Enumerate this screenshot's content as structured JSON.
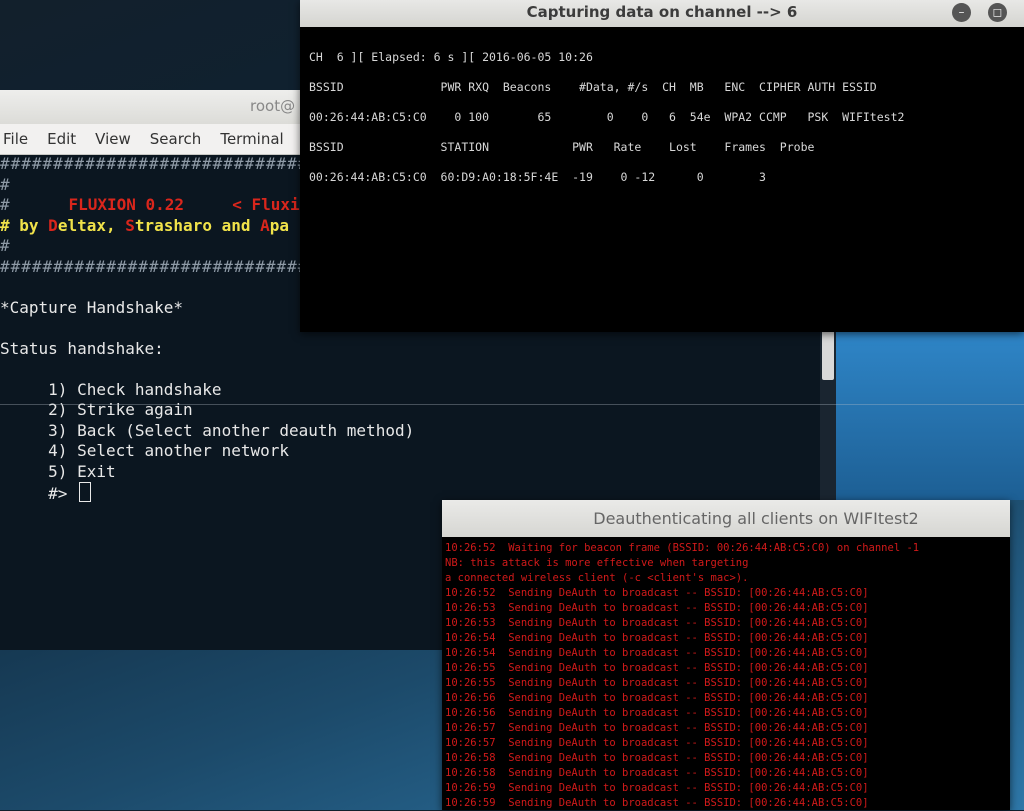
{
  "main_terminal": {
    "title": "root@",
    "menu": [
      "File",
      "Edit",
      "View",
      "Search",
      "Terminal",
      ""
    ],
    "hash_line": "#################################",
    "hash_mark": "#",
    "banner_name": "FLUXION 0.22",
    "banner_tag": "< Fluxi",
    "byline_parts": [
      "# by ",
      "D",
      "eltax, ",
      "S",
      "trasharo and ",
      "A",
      "pa"
    ],
    "capture_heading": "*Capture Handshake*",
    "status_label": "Status handshake:",
    "options": [
      "1) Check handshake",
      "2) Strike again",
      "3) Back (Select another deauth method)",
      "4) Select another network",
      "5) Exit"
    ],
    "prompt": "#>"
  },
  "capture_window": {
    "title": "Capturing data on channel --> 6",
    "lines": [
      "CH  6 ][ Elapsed: 6 s ][ 2016-06-05 10:26",
      "BSSID              PWR RXQ  Beacons    #Data, #/s  CH  MB   ENC  CIPHER AUTH ESSID",
      "00:26:44:AB:C5:C0    0 100       65        0    0   6  54e  WPA2 CCMP   PSK  WIFItest2",
      "BSSID              STATION            PWR   Rate    Lost    Frames  Probe",
      "00:26:44:AB:C5:C0  60:D9:A0:18:5F:4E  -19    0 -12      0        3"
    ]
  },
  "deauth_window": {
    "title": "Deauthenticating all clients on WIFItest2",
    "lines": [
      "10:26:52  Waiting for beacon frame (BSSID: 00:26:44:AB:C5:C0) on channel -1",
      "NB: this attack is more effective when targeting",
      "a connected wireless client (-c <client's mac>).",
      "10:26:52  Sending DeAuth to broadcast -- BSSID: [00:26:44:AB:C5:C0]",
      "10:26:53  Sending DeAuth to broadcast -- BSSID: [00:26:44:AB:C5:C0]",
      "10:26:53  Sending DeAuth to broadcast -- BSSID: [00:26:44:AB:C5:C0]",
      "10:26:54  Sending DeAuth to broadcast -- BSSID: [00:26:44:AB:C5:C0]",
      "10:26:54  Sending DeAuth to broadcast -- BSSID: [00:26:44:AB:C5:C0]",
      "10:26:55  Sending DeAuth to broadcast -- BSSID: [00:26:44:AB:C5:C0]",
      "10:26:55  Sending DeAuth to broadcast -- BSSID: [00:26:44:AB:C5:C0]",
      "10:26:56  Sending DeAuth to broadcast -- BSSID: [00:26:44:AB:C5:C0]",
      "10:26:56  Sending DeAuth to broadcast -- BSSID: [00:26:44:AB:C5:C0]",
      "10:26:57  Sending DeAuth to broadcast -- BSSID: [00:26:44:AB:C5:C0]",
      "10:26:57  Sending DeAuth to broadcast -- BSSID: [00:26:44:AB:C5:C0]",
      "10:26:58  Sending DeAuth to broadcast -- BSSID: [00:26:44:AB:C5:C0]",
      "10:26:58  Sending DeAuth to broadcast -- BSSID: [00:26:44:AB:C5:C0]",
      "10:26:59  Sending DeAuth to broadcast -- BSSID: [00:26:44:AB:C5:C0]",
      "10:26:59  Sending DeAuth to broadcast -- BSSID: [00:26:44:AB:C5:C0]"
    ]
  },
  "colors": {
    "banner_red": "#d9261c",
    "byline_yellow": "#f0e24a",
    "deauth_red": "#d11a1a"
  }
}
